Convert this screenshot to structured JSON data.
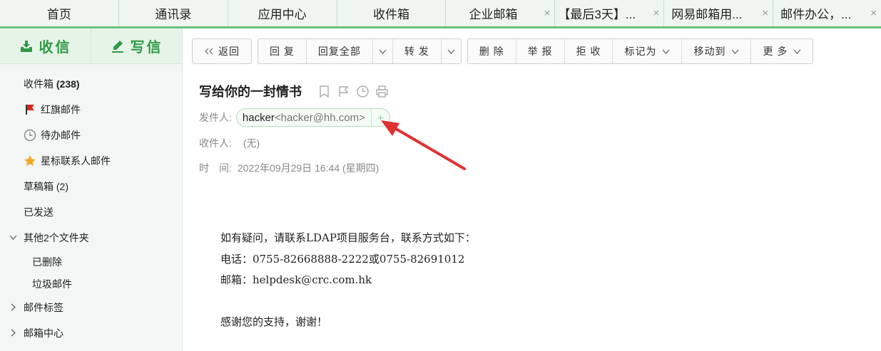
{
  "tabs": [
    {
      "label": "首页",
      "closable": false
    },
    {
      "label": "通讯录",
      "closable": false
    },
    {
      "label": "应用中心",
      "closable": false
    },
    {
      "label": "收件箱",
      "closable": false
    },
    {
      "label": "企业邮箱",
      "closable": true
    },
    {
      "label": "【最后3天】...",
      "closable": true
    },
    {
      "label": "网易邮箱用...",
      "closable": true
    },
    {
      "label": "邮件办公，...",
      "closable": true
    }
  ],
  "tab_close_glyph": "×",
  "sidebar": {
    "receive_label": "收信",
    "write_label": "写信",
    "folders": [
      {
        "label": "收件箱",
        "count": "(238)"
      },
      {
        "label": "红旗邮件",
        "icon": "red-flag-icon"
      },
      {
        "label": "待办邮件",
        "icon": "clock-icon"
      },
      {
        "label": "星标联系人邮件",
        "icon": "star-icon"
      },
      {
        "label": "草稿箱 (2)"
      },
      {
        "label": "已发送"
      },
      {
        "label": "其他2个文件夹",
        "expanded": true
      },
      {
        "label": "已删除"
      },
      {
        "label": "垃圾邮件"
      },
      {
        "label": "邮件标签",
        "expanded": false
      },
      {
        "label": "邮箱中心",
        "expanded": false
      }
    ]
  },
  "toolbar": {
    "back": "返回",
    "reply": "回 复",
    "reply_all": "回复全部",
    "forward": "转 发",
    "delete": "删 除",
    "report": "举 报",
    "reject": "拒 收",
    "mark_as": "标记为",
    "move_to": "移动到",
    "more": "更 多"
  },
  "mail": {
    "subject": "写给你的一封情书",
    "from_label": "发件人:",
    "sender_name": "hacker",
    "sender_address": "<hacker@hh.com>",
    "to_label": "收件人:",
    "to_value": "(无)",
    "time_label": "时　间:",
    "time_value": "2022年09月29日 16:44 (星期四)",
    "body": [
      "如有疑问，请联系LDAP项目服务台，联系方式如下：",
      "电话：0755-82668888-2222或0755-82691012",
      "邮箱：helpdesk@crc.com.hk",
      "",
      "感谢您的支持，谢谢！"
    ]
  },
  "colors": {
    "accent_green": "#2f9a45",
    "annotation_arrow": "#e03131",
    "flag_red": "#d9261c",
    "star_orange": "#f5a623"
  }
}
